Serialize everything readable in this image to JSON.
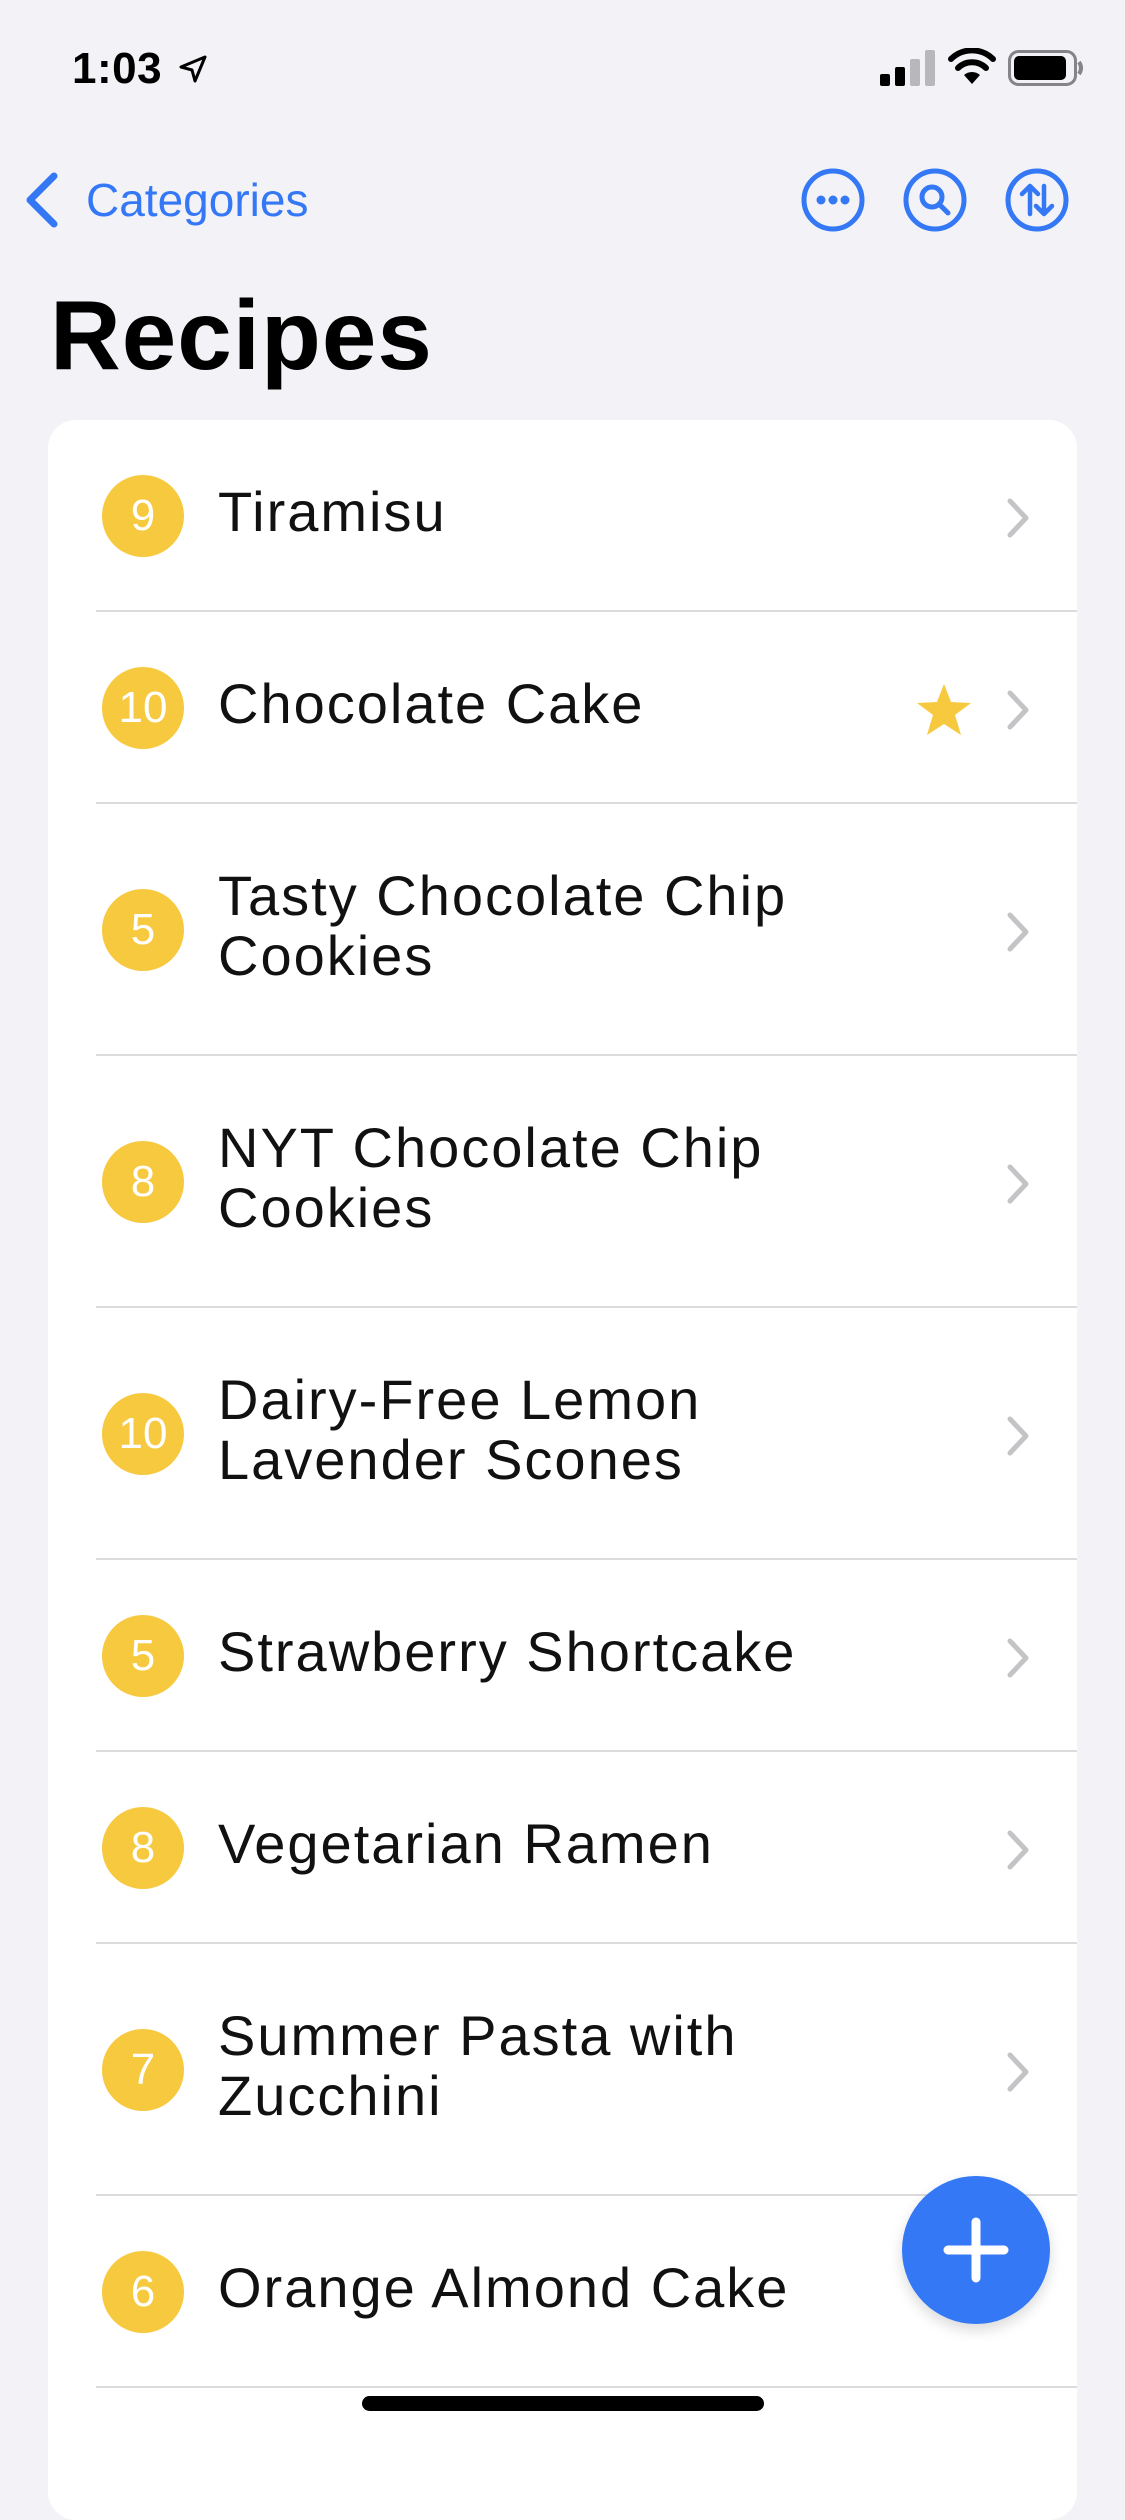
{
  "status_bar": {
    "time": "1:03"
  },
  "nav": {
    "back_label": "Categories"
  },
  "page": {
    "title": "Recipes"
  },
  "colors": {
    "accent": "#3478f6",
    "badge": "#f6c93f",
    "star": "#f6c93f"
  },
  "icons": {
    "back": "chevron-left-icon",
    "more": "ellipsis-circle-icon",
    "search": "magnifier-circle-icon",
    "sort": "sort-arrows-circle-icon",
    "row_disclosure": "chevron-right-icon",
    "favorite": "star-icon",
    "add": "plus-icon"
  },
  "recipes": [
    {
      "rating": "9",
      "name": "Tiramisu",
      "favorite": false
    },
    {
      "rating": "10",
      "name": "Chocolate Cake",
      "favorite": true
    },
    {
      "rating": "5",
      "name": "Tasty Chocolate Chip Cookies",
      "favorite": false
    },
    {
      "rating": "8",
      "name": "NYT Chocolate Chip Cookies",
      "favorite": false
    },
    {
      "rating": "10",
      "name": "Dairy-Free Lemon Lavender Scones",
      "favorite": false
    },
    {
      "rating": "5",
      "name": "Strawberry Shortcake",
      "favorite": false
    },
    {
      "rating": "8",
      "name": "Vegetarian Ramen",
      "favorite": false
    },
    {
      "rating": "7",
      "name": "Summer Pasta with Zucchini",
      "favorite": false
    },
    {
      "rating": "6",
      "name": "Orange Almond Cake",
      "favorite": false
    }
  ]
}
